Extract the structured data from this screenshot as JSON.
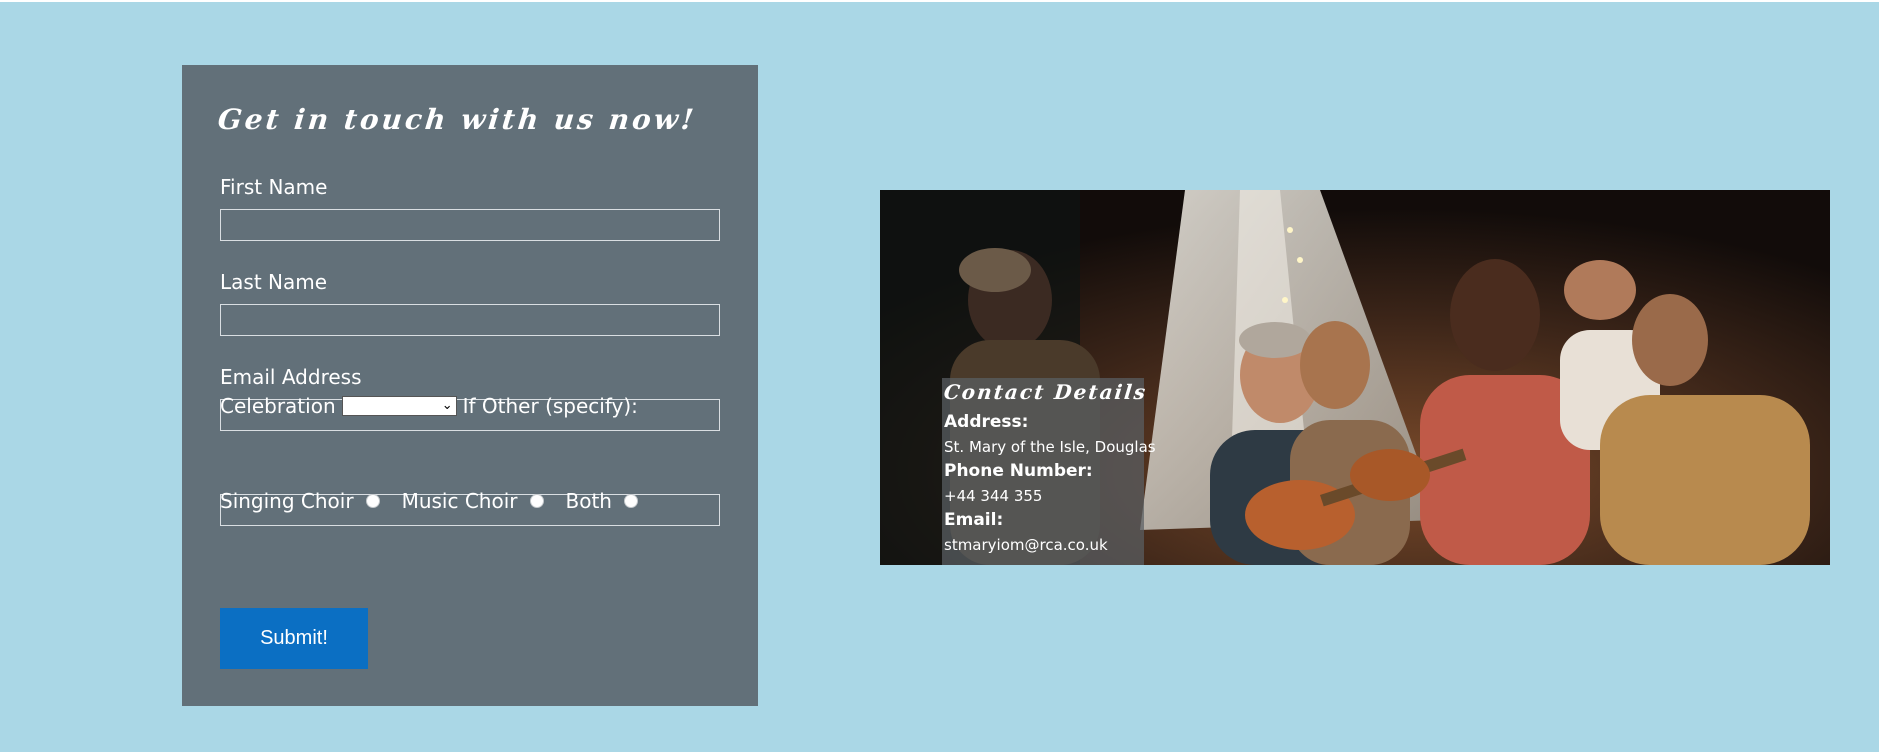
{
  "form": {
    "title": "Get in touch with us now!",
    "first_name_label": "First Name",
    "first_name_value": "",
    "last_name_label": "Last Name",
    "last_name_value": "",
    "email_label": "Email Address",
    "email_value": "",
    "celebration_label": "Celebration",
    "celebration_selected": "",
    "other_label": "If Other (specify):",
    "other_value": "",
    "radio_options": [
      "Singing Choir",
      "Music Choir",
      "Both"
    ],
    "submit_label": "Submit!"
  },
  "contact": {
    "title": "Contact Details",
    "address_heading": "Address:",
    "address_value": "St. Mary of the Isle, Douglas",
    "phone_heading": "Phone Number:",
    "phone_value": "+44 344 355",
    "email_heading": "Email:",
    "email_value": "stmaryiom@rca.co.uk"
  },
  "colors": {
    "page_background": "#aad7e6",
    "form_panel": "#627079",
    "submit_button": "#0b6fc3"
  }
}
